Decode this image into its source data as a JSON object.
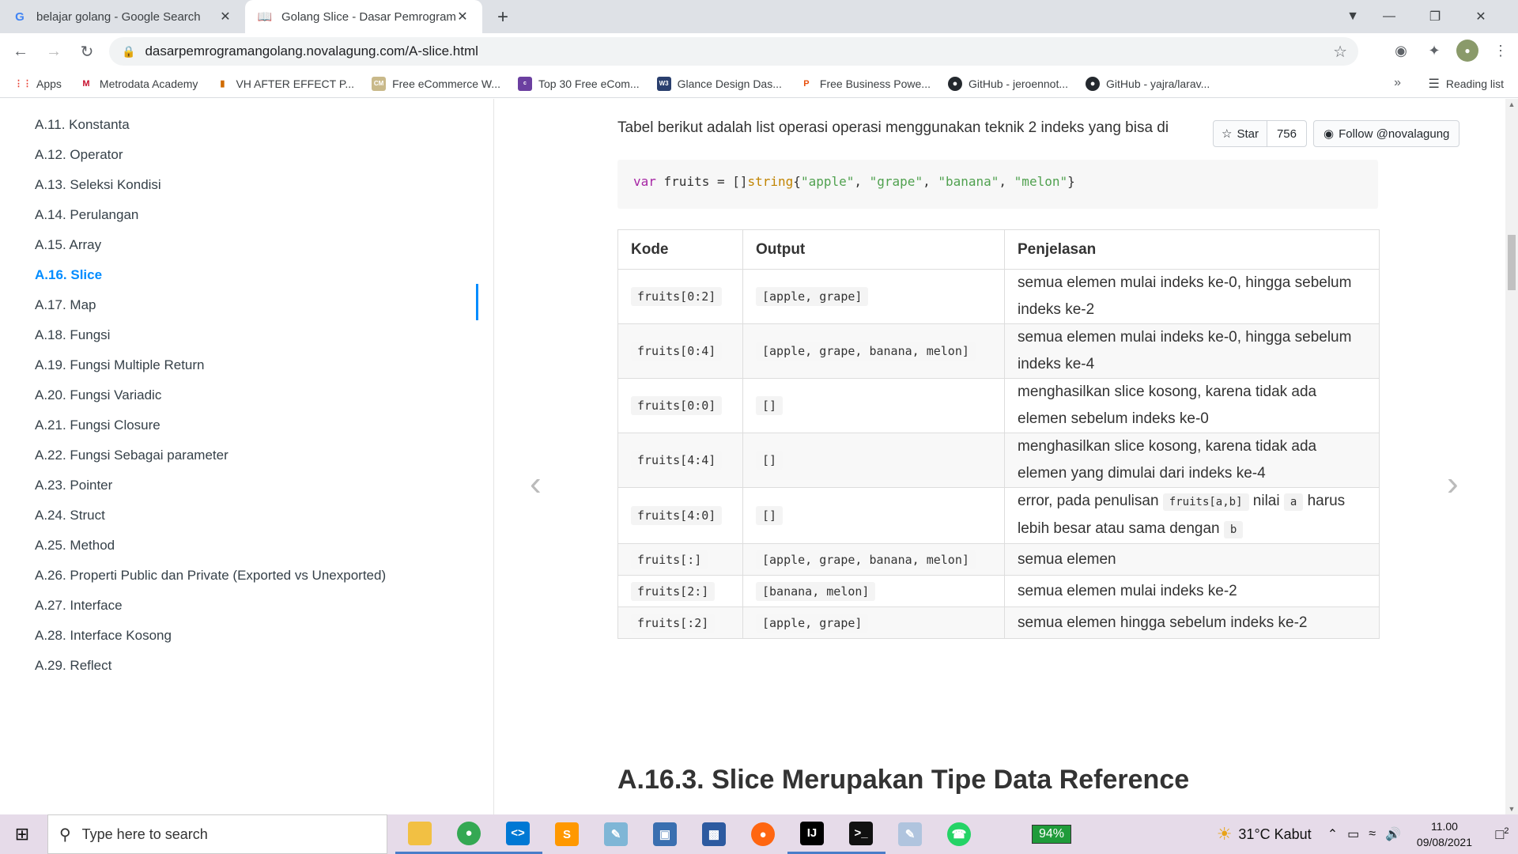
{
  "browser": {
    "tabs": [
      {
        "title": "belajar golang - Google Search",
        "icon": "google-icon"
      },
      {
        "title": "Golang Slice - Dasar Pemrogram",
        "icon": "book-icon"
      }
    ],
    "url": "dasarpemrogramangolang.novalagung.com/A-slice.html",
    "bookmarks": [
      "Apps",
      "Metrodata Academy",
      "VH AFTER EFFECT P...",
      "Free eCommerce W...",
      "Top 30 Free eCom...",
      "Glance Design Das...",
      "Free Business Powe...",
      "GitHub - jeroennot...",
      "GitHub - yajra/larav..."
    ],
    "bookmarks_more": "»",
    "reading_list": "Reading list"
  },
  "sidebar": {
    "items": [
      "A.11. Konstanta",
      "A.12. Operator",
      "A.13. Seleksi Kondisi",
      "A.14. Perulangan",
      "A.15. Array",
      "A.16. Slice",
      "A.17. Map",
      "A.18. Fungsi",
      "A.19. Fungsi Multiple Return",
      "A.20. Fungsi Variadic",
      "A.21. Fungsi Closure",
      "A.22. Fungsi Sebagai parameter",
      "A.23. Pointer",
      "A.24. Struct",
      "A.25. Method",
      "A.26. Properti Public dan Private (Exported vs Unexported)",
      "A.27. Interface",
      "A.28. Interface Kosong",
      "A.29. Reflect"
    ],
    "active_index": 5
  },
  "main": {
    "intro": "Tabel berikut adalah list operasi operasi menggunakan teknik 2 indeks yang bisa di",
    "github": {
      "star_label": "Star",
      "star_count": "756",
      "follow_label": "Follow @novalagung"
    },
    "code": {
      "kw": "var",
      "name": " fruits = []",
      "type": "string",
      "open": "{",
      "s1": "\"apple\"",
      "s2": "\"grape\"",
      "s3": "\"banana\"",
      "s4": "\"melon\"",
      "close": "}",
      "sep": ", "
    },
    "table": {
      "headers": [
        "Kode",
        "Output",
        "Penjelasan"
      ],
      "rows": [
        {
          "code": "fruits[0:2]",
          "output": "[apple, grape]",
          "explanation": "semua elemen mulai indeks ke-0, hingga sebelum indeks ke-2"
        },
        {
          "code": "fruits[0:4]",
          "output": "[apple, grape, banana, melon]",
          "explanation": "semua elemen mulai indeks ke-0, hingga sebelum indeks ke-4"
        },
        {
          "code": "fruits[0:0]",
          "output": "[]",
          "explanation": "menghasilkan slice kosong, karena tidak ada elemen sebelum indeks ke-0"
        },
        {
          "code": "fruits[4:4]",
          "output": "[]",
          "explanation": "menghasilkan slice kosong, karena tidak ada elemen yang dimulai dari indeks ke-4"
        },
        {
          "code": "fruits[4:0]",
          "output": "[]",
          "explanation_parts": [
            "error, pada penulisan",
            "fruits[a,b]",
            "nilai",
            "a",
            "harus lebih besar atau sama dengan",
            "b"
          ]
        },
        {
          "code": "fruits[:]",
          "output": "[apple, grape, banana, melon]",
          "explanation": "semua elemen"
        },
        {
          "code": "fruits[2:]",
          "output": "[banana, melon]",
          "explanation": "semua elemen mulai indeks ke-2"
        },
        {
          "code": "fruits[:2]",
          "output": "[apple, grape]",
          "explanation": "semua elemen hingga sebelum indeks ke-2"
        }
      ]
    },
    "section_heading": "A.16.3. Slice Merupakan Tipe Data Reference"
  },
  "taskbar": {
    "search_placeholder": "Type here to search",
    "battery": "94%",
    "weather": "31°C  Kabut",
    "time": "11.00",
    "date": "09/08/2021",
    "notifications": "2"
  },
  "colors": {
    "accent": "#008cff",
    "taskbar": "#e6dbe9",
    "battery": "#1f9b3a"
  }
}
